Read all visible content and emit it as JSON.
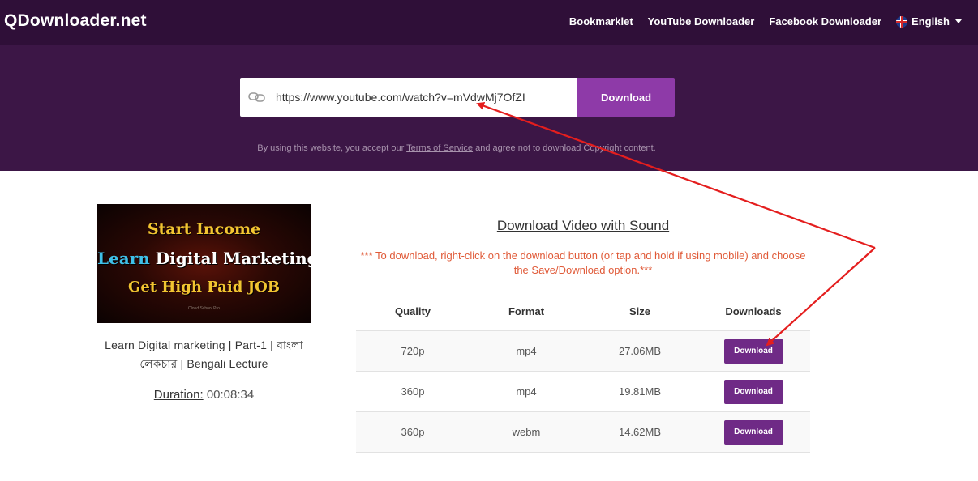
{
  "header": {
    "logo": "QDownloader.net",
    "nav": [
      "Bookmarklet",
      "YouTube Downloader",
      "Facebook Downloader"
    ],
    "language": "English"
  },
  "search": {
    "value": "https://www.youtube.com/watch?v=mVdwMj7OfZI",
    "button_label": "Download"
  },
  "terms": {
    "before": "By using this website, you accept our ",
    "link": "Terms of Service",
    "after": " and agree not to download Copyright content."
  },
  "video": {
    "thumbnail": {
      "line1": "Start Income",
      "line2_a": "Learn",
      "line2_b": " Digital Marketing",
      "line3": "Get High Paid JOB",
      "line4": "Cloud School Pro"
    },
    "title": "Learn Digital marketing | Part-1 | বাংলা লেকচার | Bengali Lecture",
    "duration_label": "Duration:",
    "duration_value": "00:08:34"
  },
  "downloads": {
    "title": "Download Video with Sound",
    "notice": "*** To download, right-click on the download button (or tap and hold if using mobile) and choose the Save/Download option.***",
    "columns": [
      "Quality",
      "Format",
      "Size",
      "Downloads"
    ],
    "rows": [
      {
        "quality": "720p",
        "format": "mp4",
        "size": "27.06MB",
        "button": "Download"
      },
      {
        "quality": "360p",
        "format": "mp4",
        "size": "19.81MB",
        "button": "Download"
      },
      {
        "quality": "360p",
        "format": "webm",
        "size": "14.62MB",
        "button": "Download"
      }
    ]
  },
  "colors": {
    "header_bg": "#3c1646",
    "navbar_bg": "#2f0f38",
    "accent": "#8e3aa8",
    "download_button": "#6f2a86",
    "notice": "#e05a38",
    "annotation_arrow": "#e41e1e"
  }
}
